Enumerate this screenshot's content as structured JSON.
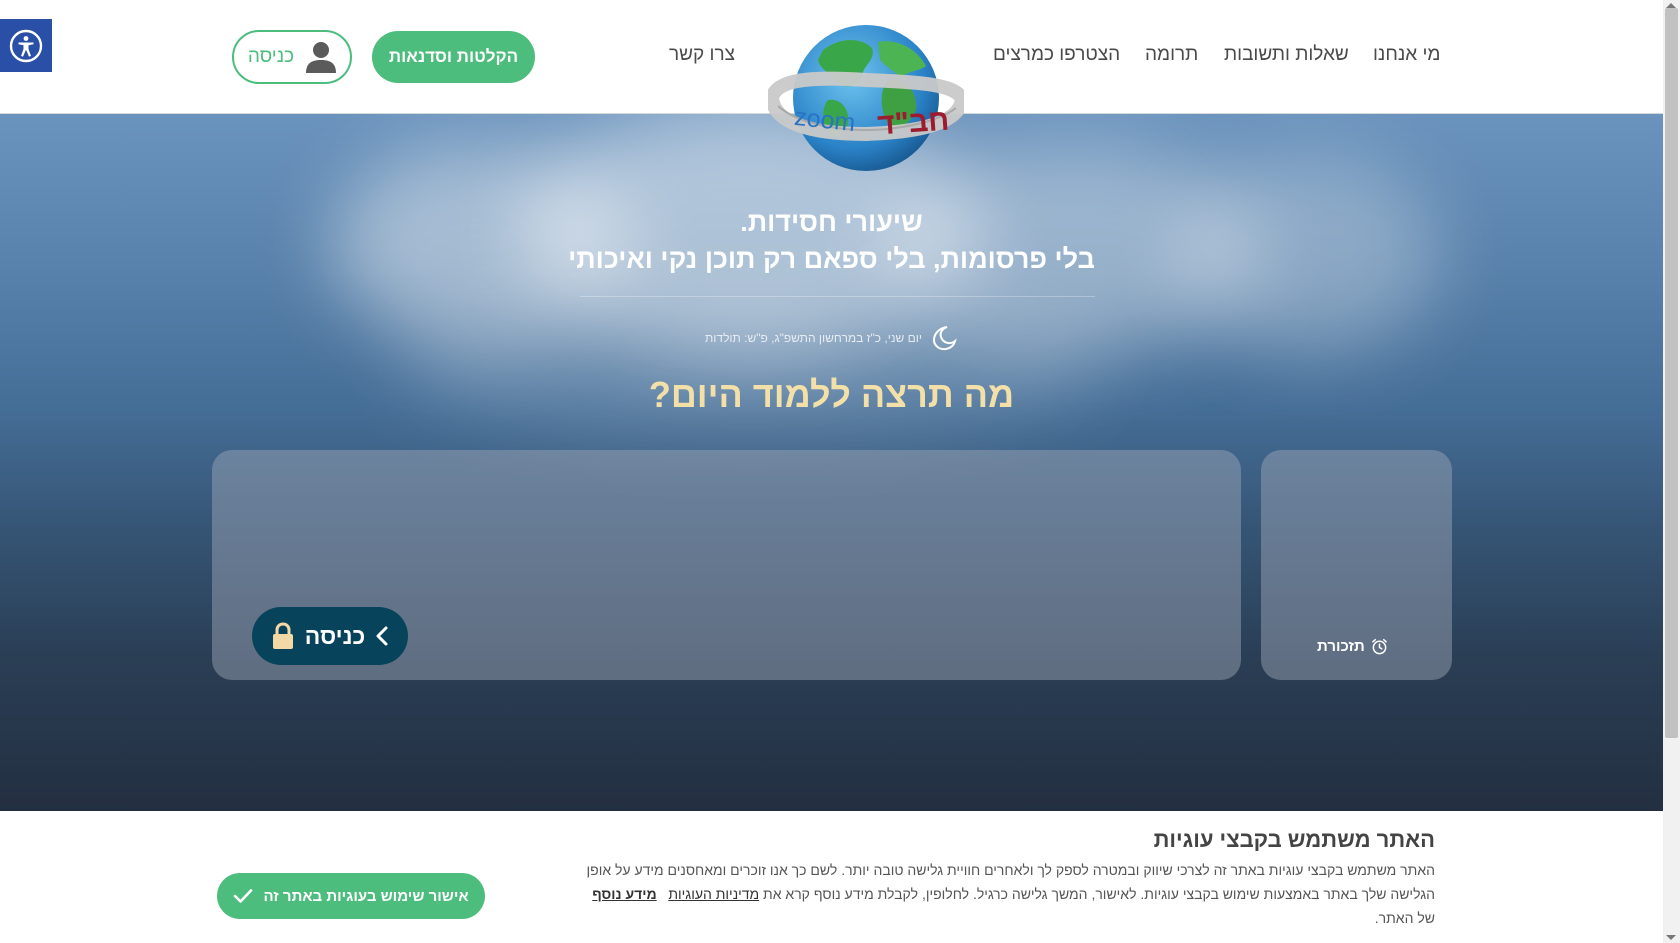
{
  "header": {
    "nav": {
      "about": "מי אנחנו",
      "faq": "שאלות ותשובות",
      "donate": "תרומה",
      "join": "הצטרפו כמרצים",
      "contact": "צרו קשר"
    },
    "recordings_button": "הקלטות וסדנאות",
    "login_button": "כניסה",
    "logo_text_hebrew": "חב\"ד",
    "logo_text_latin": "zoom"
  },
  "hero": {
    "tagline_line1": "שיעורי חסידות.",
    "tagline_line2": "בלי פרסומות, בלי ספאם רק תוכן נקי ואיכותי",
    "date": "יום שני, כ\"ז במרחשון התשפ\"ג, פ\"ש: תולדות",
    "question": "מה תרצה ללמוד היום?",
    "main_panel": {
      "enter_button": "כניסה"
    },
    "side_panel": {
      "reminder_label": "תזכורת"
    }
  },
  "cookie_bar": {
    "title": "האתר משתמש בקבצי עוגיות",
    "text": "האתר משתמש בקבצי עוגיות באתר זה לצרכי שיווק ובמטרה לספק לך ולאחרים חוויית גלישה טובה יותר. לשם כך אנו זוכרים ומאחסנים מידע על אופן הגלישה שלך באתר באמצעות שימוש בקבצי עוגיות. לאישור, המשך גלישה כרגיל. לחלופין, לקבלת מידע נוסף קרא את",
    "policy_link": "מדיניות העוגיות",
    "more_link": "מידע נוסף",
    "text_end": "של האתר.",
    "accept_button": "אישור שימוש בעוגיות באתר זה"
  },
  "colors": {
    "brand_green": "#4dbd7e",
    "dark_teal": "#07435a",
    "question_gold": "#f3dfa8",
    "accessibility_blue": "#2a4fa6"
  },
  "icons": {
    "accessibility": "accessibility-icon",
    "user": "user-icon",
    "moon": "moon-icon",
    "lock": "lock-icon",
    "chevron": "chevron-left-icon",
    "alarm": "alarm-clock-icon",
    "check": "check-icon"
  }
}
